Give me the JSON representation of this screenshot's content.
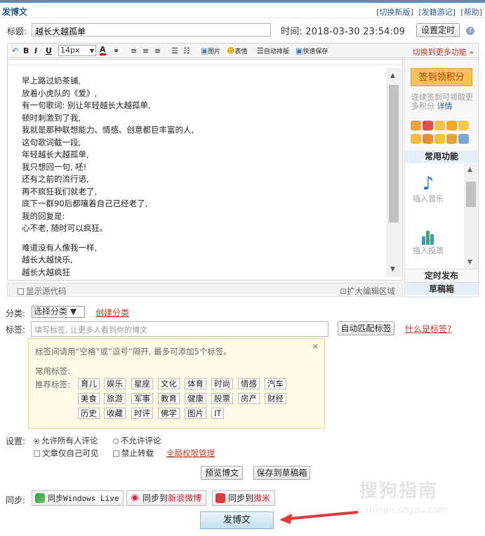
{
  "header": {
    "title": "发博文",
    "links": [
      "[切换新版]",
      "[发籍游记]",
      "[帮助]"
    ]
  },
  "title_row": {
    "label": "标题:",
    "value": "越长大越孤单",
    "time_label": "时间: 2018-03-30 23:54:09",
    "timer_button": "设置定时",
    "help_icon": "?"
  },
  "toolbar": {
    "font_size": "14px",
    "image": "图片",
    "emotion": "表情",
    "autoformat": "自动排版",
    "quicksave": "快速保存",
    "more": "切换到更多功能 »"
  },
  "editor": {
    "lines": [
      "早上路过奶茶铺,",
      "放着小虎队的《爱》,",
      "有一句歌词: 别让年轻越长大越孤单,",
      "顿时刺激到了我,",
      "我就是那种联想能力、情感、创意都巨丰富的人,",
      "这句歌词截一段,",
      "年轻越长大越孤单,",
      "我只想回一句, 呸!",
      "还有之前的流行语,",
      "再不疯狂我们就老了,",
      "底下一群90后都嚷着自己已经老了,",
      "我的回复是:",
      "心不老, 随时可以疯狂。",
      "难道没有人像我一样,",
      "越长大越快乐,",
      "越长大越疯狂"
    ],
    "show_source": "显示源代码",
    "expand": "扩大编辑区域"
  },
  "side": {
    "checkin": "签到领积分",
    "checkin_desc": "连续签到可领取更多积分",
    "details": "详情",
    "common": "常用功能",
    "insert_music": "插入音乐",
    "insert_vote": "插入投票",
    "scheduled": "定时发布",
    "drafts": "草稿箱"
  },
  "category": {
    "label": "分类:",
    "select": "选择分类 ▼",
    "create": "创建分类"
  },
  "tags": {
    "label": "标签:",
    "placeholder": "填写标签, 让更多人看到你的博文",
    "auto_button": "自动匹配标签",
    "what_link": "什么是标签?",
    "hint": "标签间请用“空格”或“逗号”隔开, 最多可添加5个标签。",
    "common_label": "常用标签:",
    "recommended_label": "推荐标签:",
    "row1": [
      "育儿",
      "娱乐",
      "星座",
      "文化",
      "体育",
      "时尚",
      "情感",
      "汽车"
    ],
    "row2": [
      "美食",
      "旅游",
      "军事",
      "教育",
      "健康",
      "股票",
      "房产",
      "财经"
    ],
    "row3": [
      "历史",
      "收藏",
      "时评",
      "佛学",
      "图片",
      "IT"
    ],
    "close": "×"
  },
  "settings": {
    "label": "设置:",
    "allow_all": "允许所有人评论",
    "disallow": "不允许评论",
    "self_only": "文章仅自己可见",
    "no_repost": "禁止转载",
    "global": "全局权限管理"
  },
  "actions": {
    "preview": "预览博文",
    "save_draft": "保存到草稿箱",
    "publish": "发博文"
  },
  "sync": {
    "label": "同步:",
    "windows": "同步Windows Live",
    "weibo_prefix": "同步到",
    "weibo": "新浪微博",
    "weimi_prefix": "同步到",
    "weimi": "微米"
  },
  "watermark": {
    "line1": "搜狗指南",
    "line2": "zhinan.sogou.com"
  },
  "colors": {
    "accent": "#2d5b91",
    "link_red": "#c0392b",
    "arrow": "#e0393e"
  }
}
